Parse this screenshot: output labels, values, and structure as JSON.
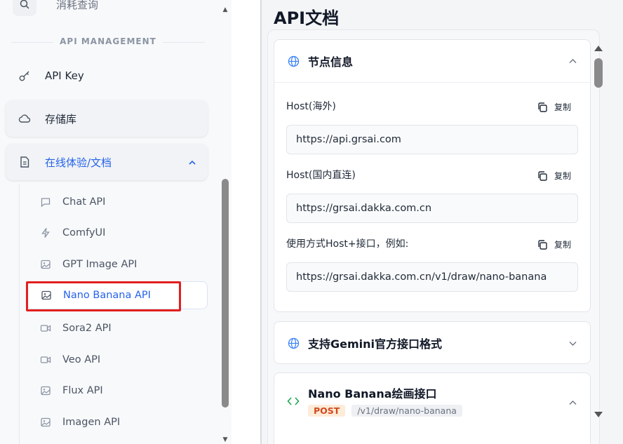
{
  "sidebar": {
    "top_item_label": "消耗查询",
    "section_label": "API MANAGEMENT",
    "items": [
      {
        "label": "API Key",
        "icon": "key-icon"
      },
      {
        "label": "存储库",
        "icon": "cloud-icon"
      },
      {
        "label": "在线体验/文档",
        "icon": "document-icon"
      }
    ],
    "sub_items": [
      {
        "label": "Chat API",
        "icon": "chat-icon"
      },
      {
        "label": "ComfyUI",
        "icon": "bolt-icon"
      },
      {
        "label": "GPT Image API",
        "icon": "image-icon"
      },
      {
        "label": "Nano Banana API",
        "icon": "image-icon"
      },
      {
        "label": "Sora2 API",
        "icon": "video-icon"
      },
      {
        "label": "Veo API",
        "icon": "video-icon"
      },
      {
        "label": "Flux API",
        "icon": "image-icon"
      },
      {
        "label": "Imagen API",
        "icon": "image-icon"
      }
    ]
  },
  "main": {
    "title": "API文档",
    "node_info": {
      "title": "节点信息",
      "copy_label": "复制",
      "fields": [
        {
          "label": "Host(海外)",
          "value": "https://api.grsai.com"
        },
        {
          "label": "Host(国内直连)",
          "value": "https://grsai.dakka.com.cn"
        },
        {
          "label": "使用方式Host+接口，例如:",
          "value": "https://grsai.dakka.com.cn/v1/draw/nano-banana"
        }
      ]
    },
    "gemini_section": {
      "title": "支持Gemini官方接口格式"
    },
    "endpoint_section": {
      "title": "Nano Banana绘画接口",
      "method": "POST",
      "path": "/v1/draw/nano-banana"
    }
  },
  "colors": {
    "accent": "#2563eb",
    "highlight": "#e21f1f",
    "post_badge_bg": "#fdecd9",
    "post_badge_text": "#d1491d"
  }
}
